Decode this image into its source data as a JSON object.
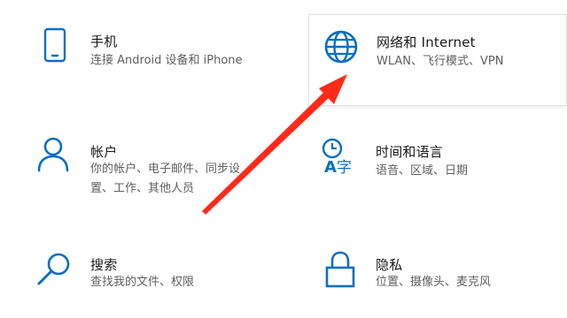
{
  "colors": {
    "icon_accent": "#0a6fc2",
    "arrow_red": "#ff2a1a",
    "title_text": "#1a1a1a",
    "desc_text": "#5f5f5f"
  },
  "tiles": {
    "phone": {
      "icon": "phone-icon",
      "title": "手机",
      "desc": [
        "连接 Android 设备和 iPhone"
      ]
    },
    "network": {
      "icon": "globe-icon",
      "title": "网络和 Internet",
      "desc": [
        "WLAN、飞行模式、VPN"
      ],
      "hovered": true
    },
    "account": {
      "icon": "person-icon",
      "title": "帐户",
      "desc": [
        "你的帐户、电子邮件、同步设",
        "置、工作、其他人员"
      ]
    },
    "time": {
      "icon": "time-language-icon",
      "title": "时间和语言",
      "desc": [
        "语音、区域、日期"
      ]
    },
    "search": {
      "icon": "magnifier-icon",
      "title": "搜索",
      "desc": [
        "查找我的文件、权限"
      ]
    },
    "privacy": {
      "icon": "lock-icon",
      "title": "隐私",
      "desc": [
        "位置、摄像头、麦克风"
      ]
    }
  },
  "annotation": {
    "icon": "red-arrow-icon",
    "points_to": "网络和 Internet"
  }
}
